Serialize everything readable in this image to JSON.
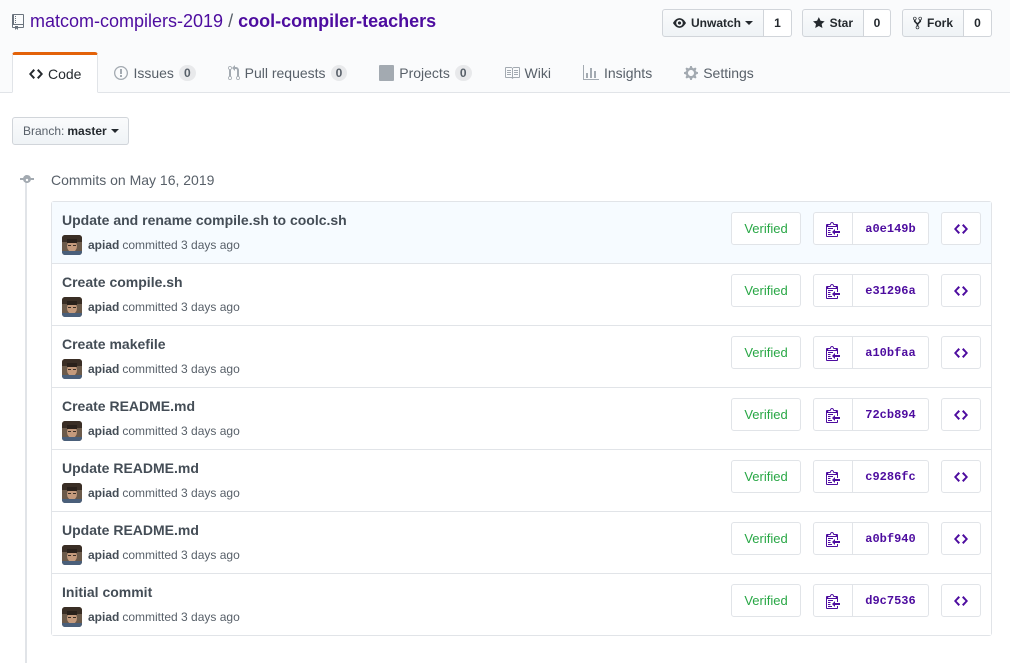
{
  "repo": {
    "owner": "matcom-compilers-2019",
    "separator": "/",
    "name": "cool-compiler-teachers"
  },
  "actions": [
    {
      "label": "Unwatch",
      "count": "1",
      "icon": "eye-icon"
    },
    {
      "label": "Star",
      "count": "0",
      "icon": "star-icon"
    },
    {
      "label": "Fork",
      "count": "0",
      "icon": "fork-icon"
    }
  ],
  "tabs": [
    {
      "label": "Code",
      "icon": "code-icon",
      "selected": true
    },
    {
      "label": "Issues",
      "icon": "issue-icon",
      "counter": "0"
    },
    {
      "label": "Pull requests",
      "icon": "pull-request-icon",
      "counter": "0"
    },
    {
      "label": "Projects",
      "icon": "project-icon",
      "counter": "0"
    },
    {
      "label": "Wiki",
      "icon": "book-icon"
    },
    {
      "label": "Insights",
      "icon": "graph-icon"
    },
    {
      "label": "Settings",
      "icon": "gear-icon"
    }
  ],
  "branch": {
    "label": "Branch:",
    "name": "master"
  },
  "commit_group": {
    "title": "Commits on May 16, 2019"
  },
  "commits": [
    {
      "title": "Update and rename compile.sh to coolc.sh",
      "author": "apiad",
      "meta": "committed 3 days ago",
      "verified": "Verified",
      "sha": "a0e149b"
    },
    {
      "title": "Create compile.sh",
      "author": "apiad",
      "meta": "committed 3 days ago",
      "verified": "Verified",
      "sha": "e31296a"
    },
    {
      "title": "Create makefile",
      "author": "apiad",
      "meta": "committed 3 days ago",
      "verified": "Verified",
      "sha": "a10bfaa"
    },
    {
      "title": "Create README.md",
      "author": "apiad",
      "meta": "committed 3 days ago",
      "verified": "Verified",
      "sha": "72cb894"
    },
    {
      "title": "Update README.md",
      "author": "apiad",
      "meta": "committed 3 days ago",
      "verified": "Verified",
      "sha": "c9286fc"
    },
    {
      "title": "Update README.md",
      "author": "apiad",
      "meta": "committed 3 days ago",
      "verified": "Verified",
      "sha": "a0bf940"
    },
    {
      "title": "Initial commit",
      "author": "apiad",
      "meta": "committed 3 days ago",
      "verified": "Verified",
      "sha": "d9c7536"
    }
  ],
  "colors": {
    "link": "#4d0c9f",
    "verified": "#28a745",
    "selected_tab_accent": "#e36209"
  }
}
